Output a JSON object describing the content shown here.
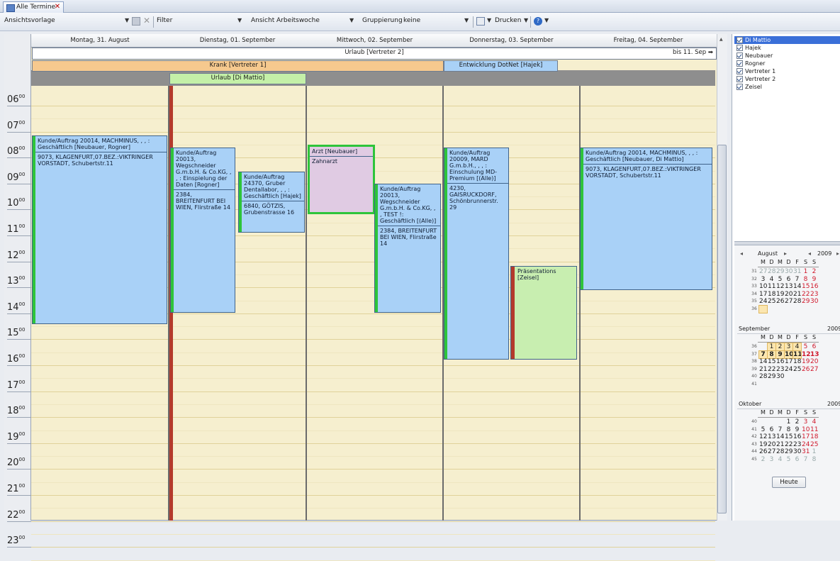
{
  "tab": {
    "label": "Alle Termine",
    "close": "✕"
  },
  "toolbar": {
    "view_template_label": "Ansichtsvorlage",
    "filter_label": "Filter",
    "view_label": "Ansicht",
    "view_value": "Arbeitswoche",
    "grouping_label": "Gruppierung",
    "grouping_value": "keine",
    "print_label": "Drucken"
  },
  "days": [
    {
      "label": "Montag, 31. August"
    },
    {
      "label": "Dienstag, 01. September"
    },
    {
      "label": "Mittwoch, 02. September"
    },
    {
      "label": "Donnerstag, 03. September"
    },
    {
      "label": "Freitag, 04. September"
    }
  ],
  "allday": {
    "urlaub_vertreter2": "Urlaub [Vertreter 2]",
    "urlaub_vertreter2_until": "bis 11. Sep",
    "krank": "Krank [Vertreter 1]",
    "entwicklung": "Entwicklung DotNet [Hajek]",
    "urlaub_dimattio": "Urlaub [Di Mattio]"
  },
  "hours": [
    "06",
    "07",
    "08",
    "09",
    "10",
    "11",
    "12",
    "13",
    "14",
    "15",
    "16",
    "17",
    "18",
    "19",
    "20",
    "21",
    "22",
    "23"
  ],
  "hour_suffix": "00",
  "events": {
    "mon1": {
      "title": "Kunde/Auftrag 20014, MACHMINUS, , , : Geschäftlich [Neubauer, Rogner]",
      "body": "9073, KLAGENFURT,07.BEZ.:VIKTRINGER VORSTADT, Schubertstr.11"
    },
    "tue1": {
      "title": "Kunde/Auftrag 20013, Wegschneider G.m.b.H. & Co.KG, , , : Einspielung der Daten [Rogner]",
      "body": "2384, BREITENFURT BEI WIEN, Flirstraße 14"
    },
    "tue2": {
      "title": "Kunde/Auftrag 24370, Gruber Dentallabor, , , : Geschäftlich [Hajek]",
      "body": "6840, GÖTZIS, Grubenstrasse 16"
    },
    "wed1": {
      "title": "Arzt [Neubauer]",
      "body": "Zahnarzt"
    },
    "wed2": {
      "title": "Kunde/Auftrag 20013, Wegschneider G.m.b.H. & Co.KG, , , TEST !: Geschäftlich [(Alle)]",
      "body": "2384, BREITENFURT BEI WIEN, Flirstraße 14"
    },
    "thu1": {
      "title": "Kunde/Auftrag 20009, MARD G.m.b.H., , , : Einschulung MD-Premium [(Alle)]",
      "body": "4230, GAISRUCKDORF, Schönbrunnerstr. 29"
    },
    "thu2": {
      "title": "Präsentations [Zeisel]",
      "body": ""
    },
    "fri1": {
      "title": "Kunde/Auftrag 20014, MACHMINUS, , , : Geschäftlich [Neubauer, Di Mattio]",
      "body": "9073, KLAGENFURT,07.BEZ.:VIKTRINGER VORSTADT, Schubertstr.11"
    }
  },
  "resources": [
    "Di Mattio",
    "Hajek",
    "Neubauer",
    "Rogner",
    "Vertreter 1",
    "Vertreter 2",
    "Zeisel"
  ],
  "minical": {
    "weekday_headers": [
      "M",
      "D",
      "M",
      "D",
      "F",
      "S",
      "S"
    ],
    "august": {
      "month": "August",
      "year": "2009",
      "weeks": [
        {
          "wk": "31",
          "days": [
            "27",
            "28",
            "29",
            "30",
            "31",
            "1",
            "2"
          ]
        },
        {
          "wk": "32",
          "days": [
            "3",
            "4",
            "5",
            "6",
            "7",
            "8",
            "9"
          ]
        },
        {
          "wk": "33",
          "days": [
            "10",
            "11",
            "12",
            "13",
            "14",
            "15",
            "16"
          ]
        },
        {
          "wk": "34",
          "days": [
            "17",
            "18",
            "19",
            "20",
            "21",
            "22",
            "23"
          ]
        },
        {
          "wk": "35",
          "days": [
            "24",
            "25",
            "26",
            "27",
            "28",
            "29",
            "30"
          ]
        },
        {
          "wk": "36",
          "days": [
            "31",
            "",
            "",
            "",
            "",
            "",
            ""
          ]
        }
      ]
    },
    "september": {
      "month": "September",
      "year": "2009",
      "weeks": [
        {
          "wk": "36",
          "days": [
            "",
            "1",
            "2",
            "3",
            "4",
            "5",
            "6"
          ]
        },
        {
          "wk": "37",
          "days": [
            "7",
            "8",
            "9",
            "10",
            "11",
            "12",
            "13"
          ]
        },
        {
          "wk": "38",
          "days": [
            "14",
            "15",
            "16",
            "17",
            "18",
            "19",
            "20"
          ]
        },
        {
          "wk": "39",
          "days": [
            "21",
            "22",
            "23",
            "24",
            "25",
            "26",
            "27"
          ]
        },
        {
          "wk": "40",
          "days": [
            "28",
            "29",
            "30",
            "",
            "",
            "",
            ""
          ]
        },
        {
          "wk": "41",
          "days": [
            "",
            "",
            "",
            "",
            "",
            "",
            ""
          ]
        }
      ]
    },
    "oktober": {
      "month": "Oktober",
      "year": "2009",
      "weeks": [
        {
          "wk": "40",
          "days": [
            "",
            "",
            "",
            "1",
            "2",
            "3",
            "4"
          ]
        },
        {
          "wk": "41",
          "days": [
            "5",
            "6",
            "7",
            "8",
            "9",
            "10",
            "11"
          ]
        },
        {
          "wk": "42",
          "days": [
            "12",
            "13",
            "14",
            "15",
            "16",
            "17",
            "18"
          ]
        },
        {
          "wk": "43",
          "days": [
            "19",
            "20",
            "21",
            "22",
            "23",
            "24",
            "25"
          ]
        },
        {
          "wk": "44",
          "days": [
            "26",
            "27",
            "28",
            "29",
            "30",
            "31",
            "1"
          ]
        },
        {
          "wk": "45",
          "days": [
            "2",
            "3",
            "4",
            "5",
            "6",
            "7",
            "8"
          ]
        }
      ]
    },
    "today_button": "Heute"
  },
  "colors": {
    "event_blue": "#a9d1f7",
    "busy_green": "#2ec43a",
    "oof_red": "#b43a2c",
    "krank_orange": "#f6c98e",
    "urlaub_green": "#c4f0a8",
    "entwicklung_blue": "#a9d1f7",
    "arzt_purple": "#e0cbe3",
    "praes_green": "#c8eeb0"
  }
}
